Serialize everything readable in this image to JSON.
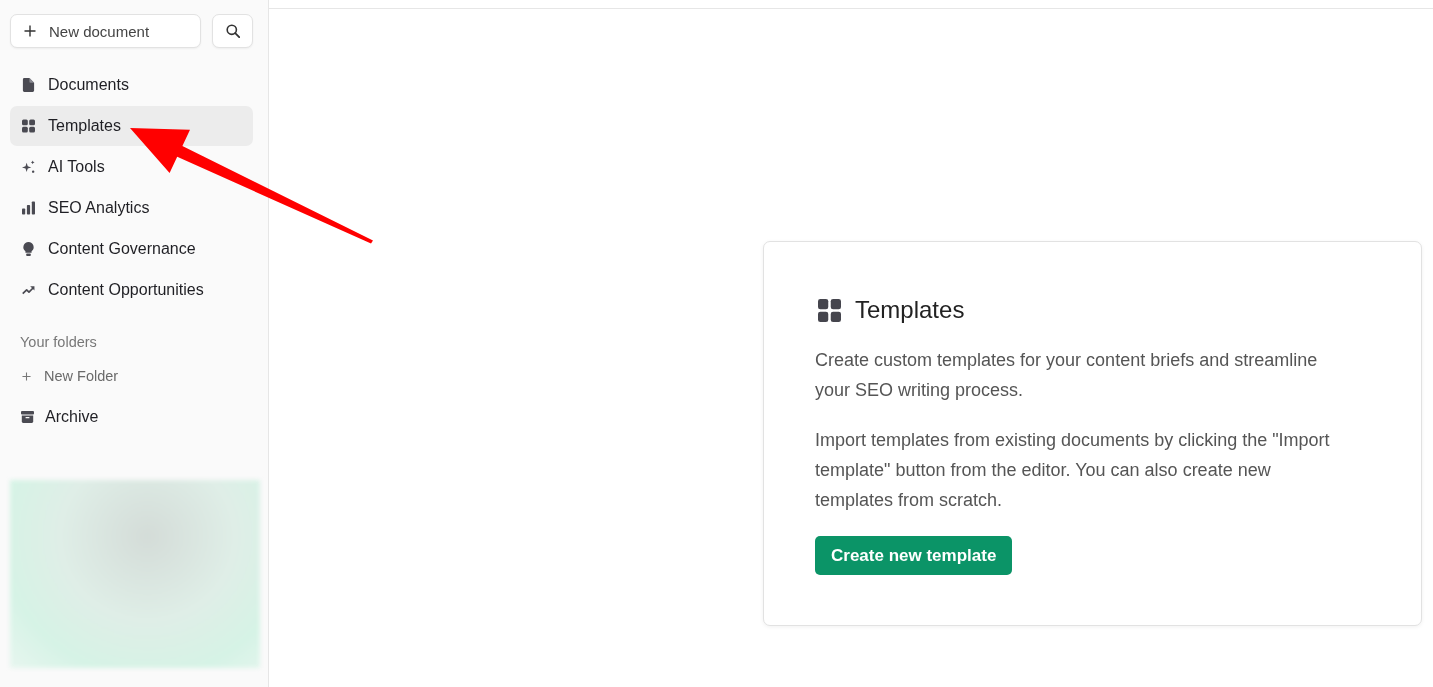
{
  "sidebar": {
    "new_document_button": {
      "label": "New document"
    },
    "nav_items": [
      {
        "label": "Documents",
        "selected": false
      },
      {
        "label": "Templates",
        "selected": true
      },
      {
        "label": "AI Tools",
        "selected": false
      },
      {
        "label": "SEO Analytics",
        "selected": false
      },
      {
        "label": "Content Governance",
        "selected": false
      },
      {
        "label": "Content Opportunities",
        "selected": false
      }
    ],
    "folders_heading": "Your folders",
    "new_folder_link": "New Folder",
    "archive_item": {
      "label": "Archive"
    }
  },
  "card": {
    "title": "Templates",
    "paragraphs": [
      "Create custom templates for your content briefs and streamline your SEO writing process.",
      "Import templates from existing documents by clicking the \"Import template\" button from the editor. You can also create new templates from scratch."
    ],
    "button": "Create new template"
  }
}
